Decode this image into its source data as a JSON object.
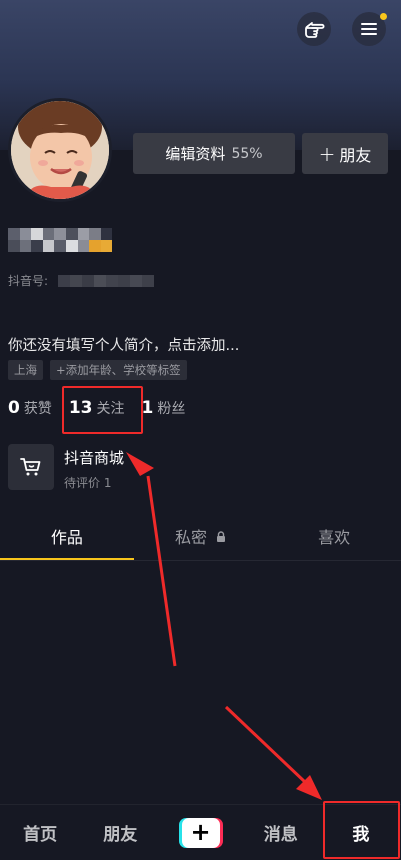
{
  "header": {
    "icons": [
      "hand-pointing-icon",
      "menu-icon"
    ],
    "notif_color": "#f9c61c"
  },
  "profile": {
    "edit_label": "编辑资料",
    "edit_percent": "55%",
    "add_friend_label": "朋友",
    "id_prefix": "抖音号:",
    "bio": "你还没有填写个人简介，点击添加...",
    "tags": [
      "上海",
      "添加年龄、学校等标签"
    ]
  },
  "stats": {
    "likes_count": "0",
    "likes_label": "获赞",
    "following_count": "13",
    "following_label": "关注",
    "followers_count": "1",
    "followers_label": "粉丝"
  },
  "shop": {
    "title": "抖音商城",
    "subtitle": "待评价 1"
  },
  "tabs": [
    {
      "label": "作品",
      "active": true
    },
    {
      "label": "私密",
      "active": false
    },
    {
      "label": "喜欢",
      "active": false
    }
  ],
  "bottom_nav": [
    {
      "label": "首页"
    },
    {
      "label": "朋友"
    },
    {
      "label": "+"
    },
    {
      "label": "消息"
    },
    {
      "label": "我"
    }
  ],
  "colors": {
    "background": "#161823",
    "accent_tab": "#f8c51c",
    "highlight": "#ef2a2a",
    "tiktok_cyan": "#27e2e9",
    "tiktok_red": "#fe2c55"
  }
}
